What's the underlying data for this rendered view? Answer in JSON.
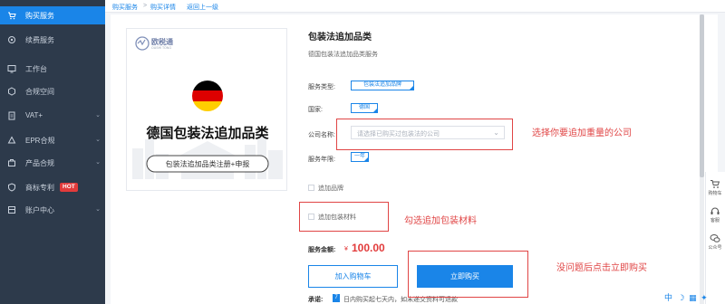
{
  "sidebar": {
    "items": [
      {
        "label": "购买服务",
        "icon": "cart-icon"
      },
      {
        "label": "续费服务",
        "icon": "renew-icon"
      },
      {
        "label": "工作台",
        "icon": "dashboard-icon"
      },
      {
        "label": "合规空间",
        "icon": "space-icon"
      },
      {
        "label": "VAT+",
        "icon": "vat-icon"
      },
      {
        "label": "EPR合规",
        "icon": "epr-icon"
      },
      {
        "label": "产品合规",
        "icon": "product-icon"
      },
      {
        "label": "商标专利",
        "icon": "trademark-icon",
        "badge": "HOT"
      },
      {
        "label": "账户中心",
        "icon": "account-icon"
      }
    ]
  },
  "breadcrumb": {
    "items": [
      "购买服务",
      "购买详情",
      "返回上一级"
    ],
    "separator": ">"
  },
  "product": {
    "logo_text": "欧税通",
    "logo_sub": "OUSHI TONG",
    "card_title": "德国包装法追加品类",
    "card_subtitle": "包装法追加品类注册+申报",
    "title": "包装法追加品类",
    "description": "德国包装法追加品类服务"
  },
  "form": {
    "service_type_label": "服务类型:",
    "service_type_value": "包装法追加品牌",
    "country_label": "国家:",
    "country_value": "德国",
    "company_label": "公司名称:",
    "company_placeholder": "请选择已购买过包装法的公司",
    "years_label": "服务年限:",
    "years_value": "一年",
    "add_brand_label": "追加品牌",
    "add_material_label": "追加包装材料"
  },
  "order": {
    "price_label": "服务金额:",
    "currency": "¥",
    "price": "100.00",
    "cart_button": "加入购物车",
    "buy_button": "立即购买",
    "promise_label": "承诺:",
    "promise_badge": "7",
    "promise_text": "日内购买起七天内，如未递交资料可退款"
  },
  "annotations": {
    "select_company": "选择你要追加重量的公司",
    "check_material": "勾选追加包装材料",
    "click_buy": "没问题后点击立即购买"
  },
  "right_rail": {
    "items": [
      {
        "label": "购物车",
        "icon": "cart-icon"
      },
      {
        "label": "客服",
        "icon": "headset-icon"
      },
      {
        "label": "公众号",
        "icon": "wechat-icon"
      }
    ]
  },
  "ime_text": "中",
  "colors": {
    "sidebar_bg": "#2d3a4b",
    "accent": "#1a85e8",
    "annotation_red": "#e04545",
    "price_red": "#e23b3b",
    "flag_black": "#000000",
    "flag_red": "#dd0000",
    "flag_gold": "#ffce00"
  }
}
